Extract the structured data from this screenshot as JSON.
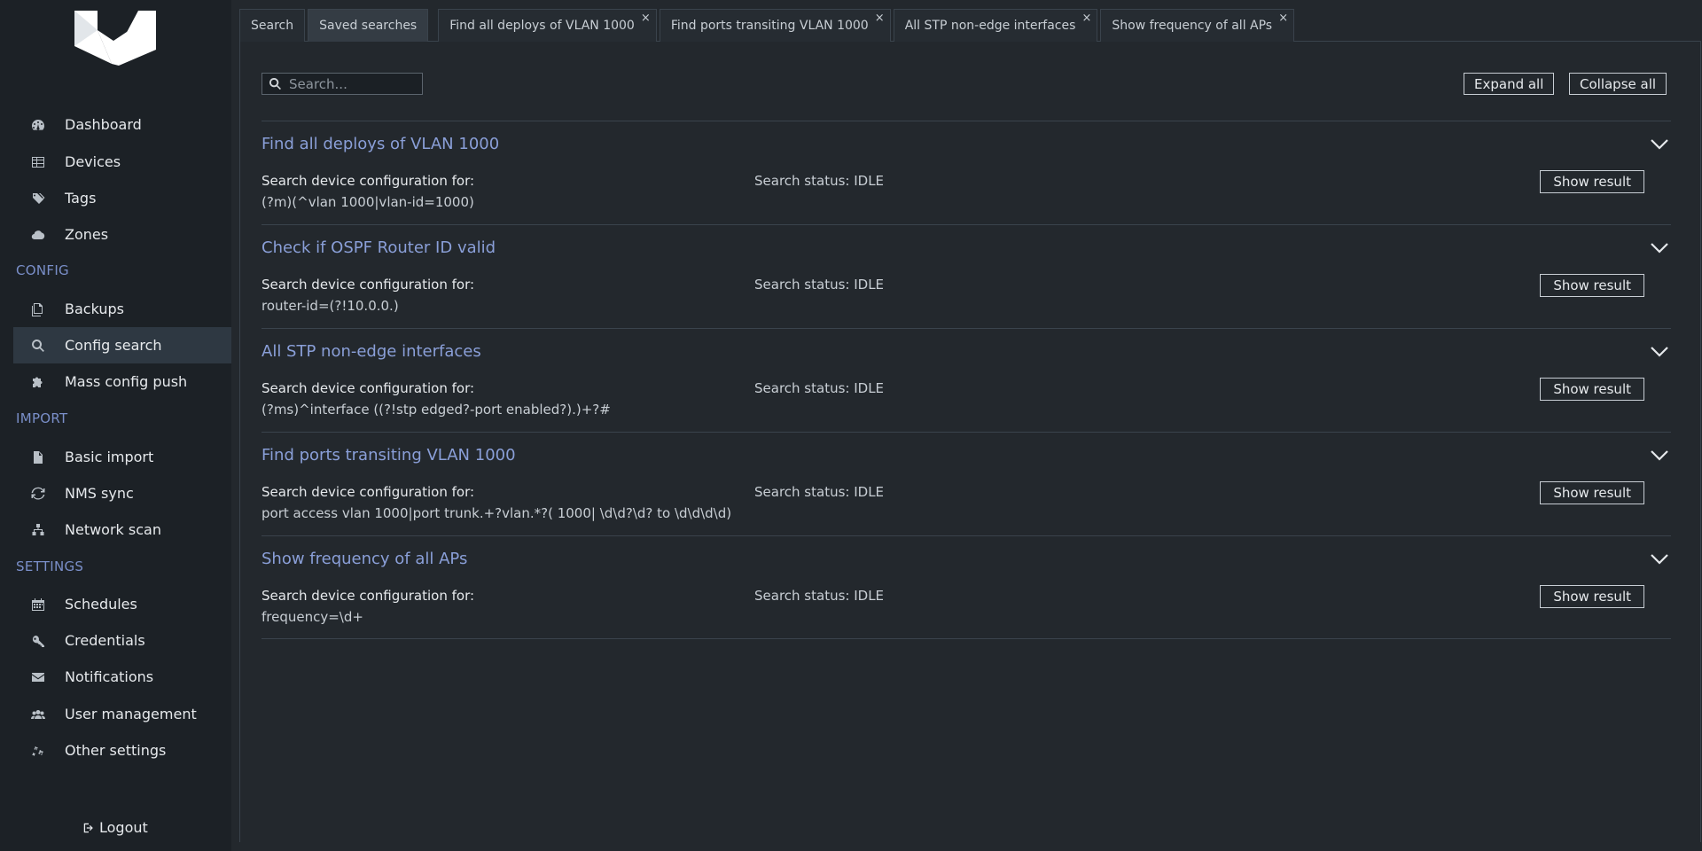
{
  "sidebar": {
    "items": [
      {
        "label": "Dashboard",
        "icon": "dashboard-icon"
      },
      {
        "label": "Devices",
        "icon": "table-icon"
      },
      {
        "label": "Tags",
        "icon": "tags-icon"
      },
      {
        "label": "Zones",
        "icon": "cloud-icon"
      },
      {
        "label": "Backups",
        "icon": "copy-icon"
      },
      {
        "label": "Config search",
        "icon": "search-icon"
      },
      {
        "label": "Mass config push",
        "icon": "puzzle-icon"
      },
      {
        "label": "Basic import",
        "icon": "file-icon"
      },
      {
        "label": "NMS sync",
        "icon": "sync-icon"
      },
      {
        "label": "Network scan",
        "icon": "sitemap-icon"
      },
      {
        "label": "Schedules",
        "icon": "calendar-icon"
      },
      {
        "label": "Credentials",
        "icon": "key-icon"
      },
      {
        "label": "Notifications",
        "icon": "envelope-icon"
      },
      {
        "label": "User management",
        "icon": "users-icon"
      },
      {
        "label": "Other settings",
        "icon": "cogs-icon"
      }
    ],
    "sections": {
      "config": "CONFIG",
      "import": "IMPORT",
      "settings": "SETTINGS"
    },
    "logout": "Logout",
    "active_item": "Config search"
  },
  "tabs": [
    {
      "label": "Search"
    },
    {
      "label": "Saved searches"
    },
    {
      "label": "Find all deploys of VLAN 1000",
      "close": "×"
    },
    {
      "label": "Find ports transiting VLAN 1000",
      "close": "×"
    },
    {
      "label": "All STP non-edge interfaces",
      "close": "×"
    },
    {
      "label": "Show frequency of all APs",
      "close": "×"
    }
  ],
  "search": {
    "placeholder": "Search..."
  },
  "toolbar": {
    "expand_all": "Expand all",
    "collapse_all": "Collapse all"
  },
  "saved_searches": [
    {
      "title": "Find all deploys of VLAN 1000",
      "label": "Search device configuration for:",
      "pattern": "(?m)(^vlan 1000|vlan-id=1000)",
      "status": "Search status: IDLE",
      "button": "Show result"
    },
    {
      "title": "Check if OSPF Router ID valid",
      "label": "Search device configuration for:",
      "pattern": "router-id=(?!10.0.0.)",
      "status": "Search status: IDLE",
      "button": "Show result"
    },
    {
      "title": "All STP non-edge interfaces",
      "label": "Search device configuration for:",
      "pattern": "(?ms)^interface ((?!stp edged?-port enabled?).)+?#",
      "status": "Search status: IDLE",
      "button": "Show result"
    },
    {
      "title": "Find ports transiting VLAN 1000",
      "label": "Search device configuration for:",
      "pattern": "port access vlan 1000|port trunk.+?vlan.*?( 1000| \\d\\d?\\d? to \\d\\d\\d\\d)",
      "status": "Search status: IDLE",
      "button": "Show result"
    },
    {
      "title": "Show frequency of all APs",
      "label": "Search device configuration for:",
      "pattern": "frequency=\\d+",
      "status": "Search status: IDLE",
      "button": "Show result"
    }
  ],
  "colors": {
    "accent": "#8a9fd8",
    "section": "#7a8fc9",
    "sidebar_bg": "#1c2126",
    "main_bg": "#23282d",
    "active_bg": "#2e3842"
  }
}
